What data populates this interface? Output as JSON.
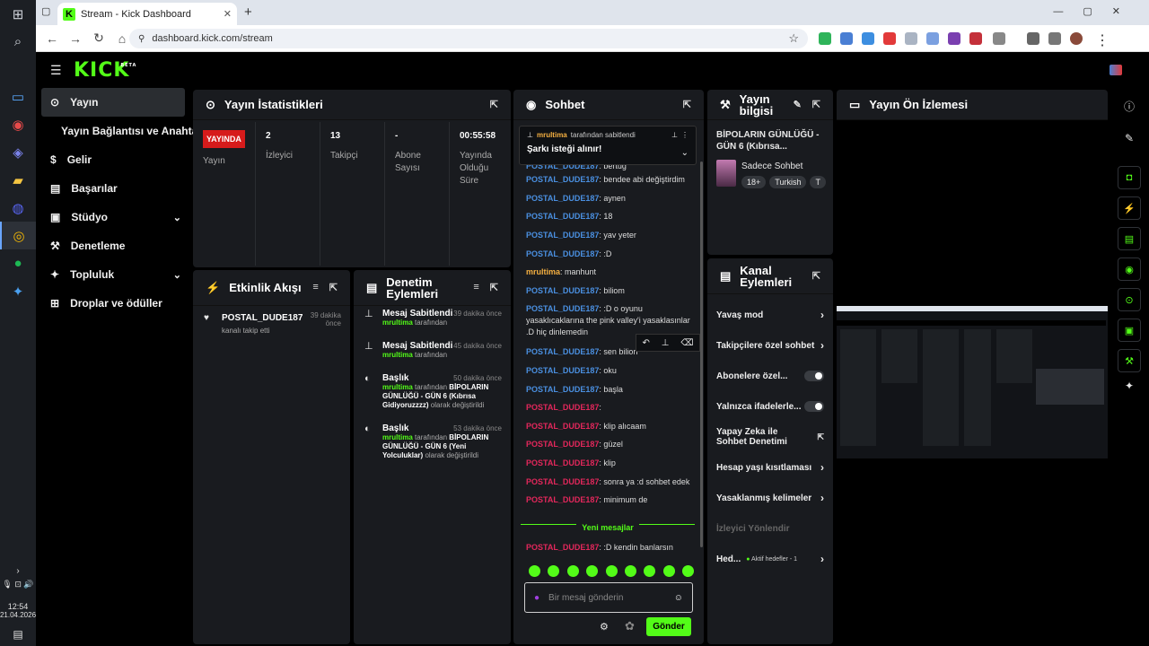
{
  "browser": {
    "tab_title": "Stream - Kick Dashboard",
    "url": "dashboard.kick.com/stream"
  },
  "taskbar": {
    "time": "12:54",
    "date": "21.04.2026"
  },
  "kick": {
    "logo": "KICK",
    "beta": "BETA"
  },
  "sidebar": {
    "items": [
      {
        "label": "Yayın"
      },
      {
        "label": "Yayın Bağlantısı ve Anahtarı"
      },
      {
        "label": "Gelir"
      },
      {
        "label": "Başarılar"
      },
      {
        "label": "Stüdyo"
      },
      {
        "label": "Denetleme"
      },
      {
        "label": "Topluluk"
      },
      {
        "label": "Droplar ve ödüller"
      }
    ]
  },
  "stats": {
    "title": "Yayın İstatistikleri",
    "live_badge": "YAYINDA",
    "status_label": "Yayın",
    "viewers": "2",
    "viewers_label": "İzleyici",
    "followers": "13",
    "followers_label": "Takipçi",
    "subs": "-",
    "subs_label": "Abone Sayısı",
    "duration": "00:55:58",
    "duration_label": "Yayında Olduğu Süre"
  },
  "activity": {
    "title": "Etkinlik Akışı",
    "user": "POSTAL_DUDE187",
    "action": "kanalı takip etti",
    "time": "39 dakika önce"
  },
  "modlog": {
    "title": "Denetim Eylemleri",
    "items": [
      {
        "title": "Mesaj Sabitlendi",
        "time": "39 dakika önce",
        "user": "mrultima",
        "suffix": "tarafından",
        "extra": "",
        "changed": ""
      },
      {
        "title": "Mesaj Sabitlendi",
        "time": "45 dakika önce",
        "user": "mrultima",
        "suffix": "tarafından",
        "extra": "",
        "changed": ""
      },
      {
        "title": "Başlık",
        "time": "50 dakika önce",
        "user": "mrultima",
        "suffix": "tarafından",
        "extra": "BİPOLARIN GÜNLÜĞÜ - GÜN 6 (Kıbrısa Gidiyoruzzzz)",
        "changed": "olarak değiştirildi"
      },
      {
        "title": "Başlık",
        "time": "53 dakika önce",
        "user": "mrultima",
        "suffix": "tarafından",
        "extra": "BİPOLARIN GÜNLÜĞÜ - GÜN 6 (Yeni Yolculuklar)",
        "changed": "olarak değiştirildi"
      }
    ]
  },
  "chat": {
    "title": "Sohbet",
    "pinned_by": "mrultima",
    "pinned_label": "tarafından sabitlendi",
    "pinned_msg": "Şarkı isteği alınır!",
    "new_messages": "Yeni mesajlar",
    "placeholder": "Bir mesaj gönderin",
    "send": "Gönder",
    "messages": [
      {
        "user": "POSTAL_DUDE187",
        "c": "u-blue",
        "text": ": bertug"
      },
      {
        "user": "POSTAL_DUDE187",
        "c": "u-blue",
        "text": ": bendee abi değiştirdim"
      },
      {
        "user": "POSTAL_DUDE187",
        "c": "u-blue",
        "text": ": aynen"
      },
      {
        "user": "POSTAL_DUDE187",
        "c": "u-blue",
        "text": ": 18"
      },
      {
        "user": "POSTAL_DUDE187",
        "c": "u-blue",
        "text": ": yav yeter"
      },
      {
        "user": "POSTAL_DUDE187",
        "c": "u-blue",
        "text": ": :D"
      },
      {
        "user": "mrultima",
        "c": "u-yel",
        "text": ": manhunt"
      },
      {
        "user": "POSTAL_DUDE187",
        "c": "u-blue",
        "text": ": biliom"
      },
      {
        "user": "POSTAL_DUDE187",
        "c": "u-blue",
        "text": ": :D o oyunu yasaklıcaklarına the pink valley'i yasaklasınlar .D hiç dinlemedin"
      },
      {
        "user": "POSTAL_DUDE187",
        "c": "u-blue",
        "text": ": sen bilion"
      },
      {
        "user": "POSTAL_DUDE187",
        "c": "u-blue",
        "text": ": oku"
      },
      {
        "user": "POSTAL_DUDE187",
        "c": "u-blue",
        "text": ": başla"
      },
      {
        "user": "POSTAL_DUDE187",
        "c": "u-red",
        "text": ":"
      },
      {
        "user": "POSTAL_DUDE187",
        "c": "u-red",
        "text": ": klip alıcaam"
      },
      {
        "user": "POSTAL_DUDE187",
        "c": "u-red",
        "text": ": güzel"
      },
      {
        "user": "POSTAL_DUDE187",
        "c": "u-red",
        "text": ": klip"
      },
      {
        "user": "POSTAL_DUDE187",
        "c": "u-red",
        "text": ": sonra ya :d sohbet edek"
      },
      {
        "user": "POSTAL_DUDE187",
        "c": "u-red",
        "text": ": minimum de"
      }
    ],
    "last": {
      "user": "POSTAL_DUDE187",
      "text": ": :D kendin banlarsın"
    }
  },
  "info": {
    "title": "Yayın bilgisi",
    "stream_title": "BİPOLARIN GÜNLÜĞÜ - GÜN 6 (Kıbrısa...",
    "category": "Sadece Sohbet",
    "tags": [
      "18+",
      "Turkish",
      "T"
    ]
  },
  "channel": {
    "title": "Kanal Eylemleri",
    "actions": [
      {
        "label": "Yavaş mod"
      },
      {
        "label": "Takipçilere özel sohbet"
      },
      {
        "label": "Abonelere özel..."
      },
      {
        "label": "Yalnızca ifadelerle..."
      },
      {
        "label": "Yapay Zeka ile Sohbet Denetimi"
      },
      {
        "label": "Hesap yaşı kısıtlaması"
      },
      {
        "label": "Yasaklanmış kelimeler"
      },
      {
        "label": "İzleyici Yönlendir"
      },
      {
        "label": "Hed..."
      }
    ],
    "goals": "Aktif hedefler - 1"
  },
  "preview": {
    "title": "Yayın Ön İzlemesi"
  }
}
